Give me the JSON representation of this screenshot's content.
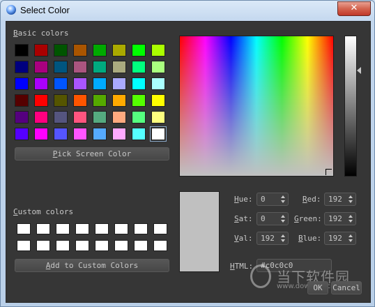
{
  "window": {
    "title": "Select Color",
    "close_glyph": "✕"
  },
  "basic_colors": {
    "label": "Basic colors",
    "swatches": [
      "#000000",
      "#aa0000",
      "#005500",
      "#aa5500",
      "#00aa00",
      "#aaaa00",
      "#00ff00",
      "#aaff00",
      "#00007f",
      "#aa007f",
      "#00557f",
      "#aa557f",
      "#00aa7f",
      "#aaaa7f",
      "#00ff7f",
      "#aaff7f",
      "#0000ff",
      "#aa00ff",
      "#0055ff",
      "#aa55ff",
      "#00aaff",
      "#aaaaff",
      "#00ffff",
      "#aaffff",
      "#550000",
      "#ff0000",
      "#555500",
      "#ff5500",
      "#55aa00",
      "#ffaa00",
      "#55ff00",
      "#ffff00",
      "#55007f",
      "#ff007f",
      "#55557f",
      "#ff557f",
      "#55aa7f",
      "#ffaa7f",
      "#55ff7f",
      "#ffff7f",
      "#5500ff",
      "#ff00ff",
      "#5555ff",
      "#ff55ff",
      "#55aaff",
      "#ffaaff",
      "#55ffff",
      "#ffffff"
    ],
    "selected_index": 47
  },
  "pick_screen_label": "Pick Screen Color",
  "custom_colors": {
    "label": "Custom colors",
    "swatches": [
      "#ffffff",
      "#ffffff",
      "#ffffff",
      "#ffffff",
      "#ffffff",
      "#ffffff",
      "#ffffff",
      "#ffffff",
      "#ffffff",
      "#ffffff",
      "#ffffff",
      "#ffffff",
      "#ffffff",
      "#ffffff",
      "#ffffff",
      "#ffffff"
    ]
  },
  "add_custom_label": "Add to Custom Colors",
  "current_color": "#c0c0c0",
  "fields": {
    "hue": {
      "label": "Hue:",
      "value": "0"
    },
    "sat": {
      "label": "Sat:",
      "value": "0"
    },
    "val": {
      "label": "Val:",
      "value": "192"
    },
    "red": {
      "label": "Red:",
      "value": "192"
    },
    "green": {
      "label": "Green:",
      "value": "192"
    },
    "blue": {
      "label": "Blue:",
      "value": "192"
    },
    "html": {
      "label": "HTML:",
      "value": "#c0c0c0"
    }
  },
  "ok_label": "OK",
  "cancel_label": "Cancel",
  "watermark": {
    "cn": "当下软件园",
    "en": "www.downxia.com"
  }
}
